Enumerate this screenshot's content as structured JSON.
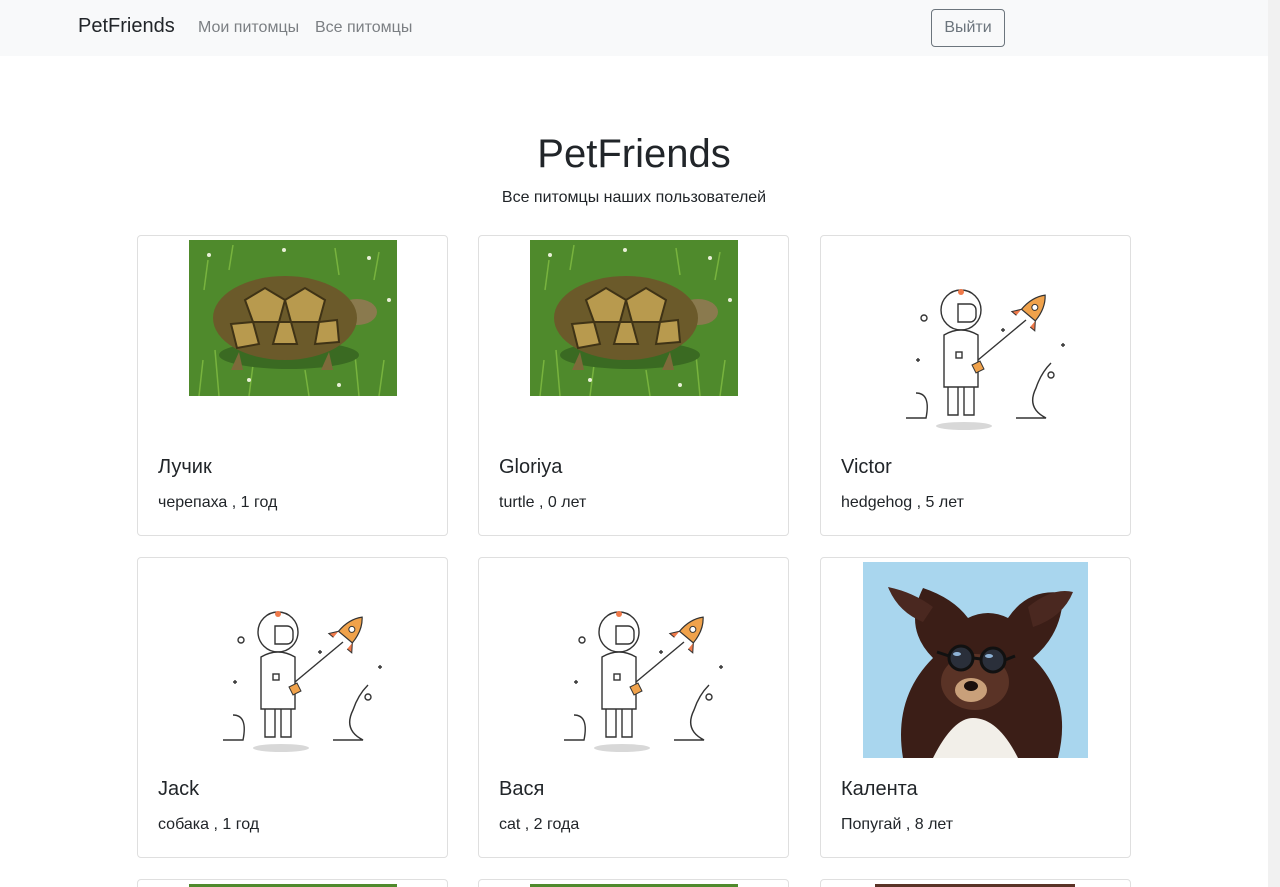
{
  "nav": {
    "brand": "PetFriends",
    "my_pets": "Мои питомцы",
    "all_pets": "Все питомцы",
    "logout": "Выйти"
  },
  "header": {
    "title": "PetFriends",
    "subtitle": "Все питомцы наших пользователей"
  },
  "pets": [
    {
      "name": "Лучик",
      "info": "черепаха , 1 год",
      "photo": "turtle-photo"
    },
    {
      "name": "Gloriya",
      "info": "turtle , 0 лет",
      "photo": "turtle-photo"
    },
    {
      "name": "Victor",
      "info": "hedgehog , 5 лет",
      "photo": "astronaut-placeholder"
    },
    {
      "name": "Jack",
      "info": "собака , 1 год",
      "photo": "astronaut-placeholder"
    },
    {
      "name": "Вася",
      "info": "cat , 2 года",
      "photo": "astronaut-placeholder"
    },
    {
      "name": "Калента",
      "info": "Попугай , 8 лет",
      "photo": "dog-sunglasses-photo"
    }
  ],
  "colors": {
    "navbar_bg": "#f8f9fa",
    "card_border": "#dfdfdf",
    "grass": "#4f8a2c",
    "sky": "#a9d6ee",
    "rocket": "#f0a24b"
  }
}
